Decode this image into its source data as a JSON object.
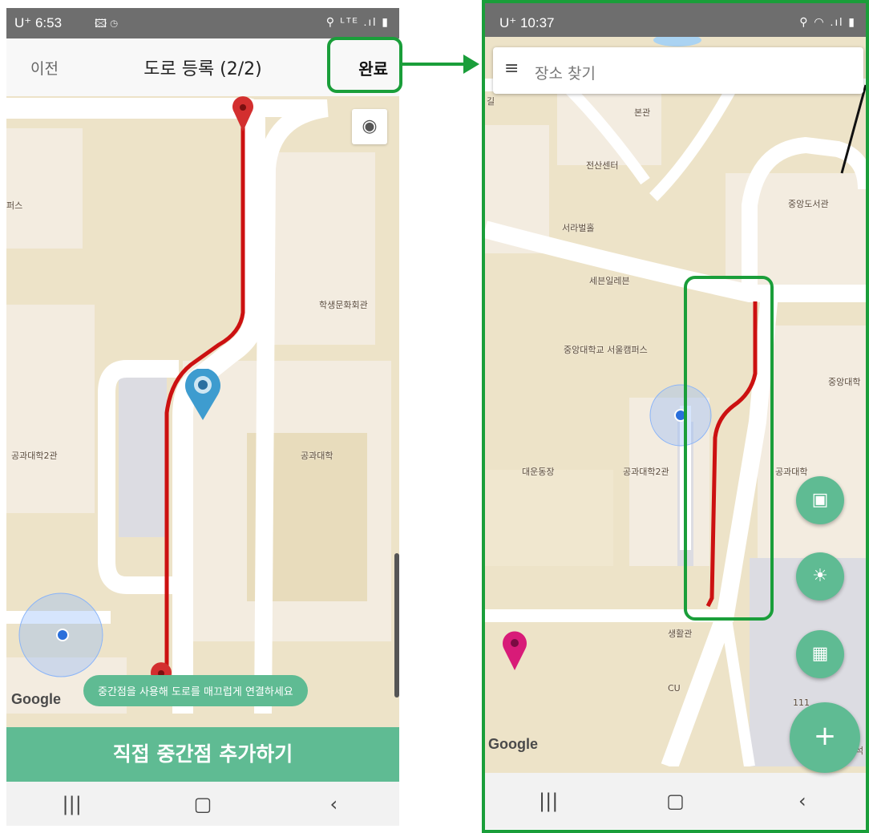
{
  "left_phone": {
    "status": {
      "time": "U⁺ 6:53",
      "icons_left": "🖾 ◷",
      "icons_right": "⚲ ᴸᵀᴱ .ıl ▮"
    },
    "appbar": {
      "prev_label": "이전",
      "title": "도로 등록 (2/2)",
      "done_label": "완료"
    },
    "map_labels": {
      "l1": "퍼스",
      "l2": "학생문화회관",
      "l3": "공과대학2관",
      "l4": "공과대학"
    },
    "toast": "중간점을 사용해 도로를 매끄럽게 연결하세요",
    "google": "Google",
    "add_button": "직접 중간점 추가하기",
    "nav": {
      "recent": "|||",
      "home": "▢",
      "back": "‹"
    },
    "icons": {
      "my_location": "my-location-icon",
      "pin": "map-pin-icon"
    }
  },
  "right_phone": {
    "status": {
      "time": "U⁺ 10:37",
      "icons_right": "⚲ ◠ .ıl ▮"
    },
    "search": {
      "menu": "≡",
      "placeholder": "장소 찾기"
    },
    "map_labels": {
      "r1": "본관",
      "r2": "전산센터",
      "r3": "중앙도서관",
      "r4": "서라벌홀",
      "r5": "세븐일레븐",
      "r6": "중앙대학교 서울캠퍼스",
      "r7": "중앙대학",
      "r8": "대운동장",
      "r9": "공과대학2관",
      "r10": "공과대학",
      "r11": "생활관",
      "r12": "CU",
      "r13": "111",
      "r14": "석",
      "r15": "길"
    },
    "google": "Google",
    "fabs": {
      "bus": "bus-icon",
      "walk": "walk-icon",
      "building": "building-icon",
      "add": "+"
    },
    "nav": {
      "recent": "|||",
      "home": "▢",
      "back": "‹"
    }
  },
  "colors": {
    "accent": "#5fbb93",
    "route": "#cc1111",
    "highlight": "#1a9e3a",
    "map_bg": "#ede3c8",
    "road": "#ffffff"
  }
}
